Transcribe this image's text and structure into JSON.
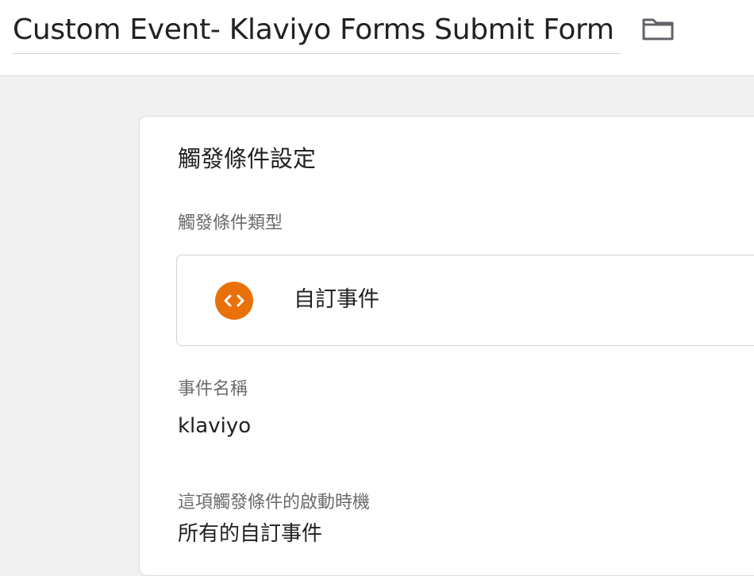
{
  "header": {
    "title": "Custom Event- Klaviyo Forms Submit Form",
    "folder_icon": "folder-icon"
  },
  "trigger_config": {
    "section_title": "觸發條件設定",
    "trigger_type_label": "觸發條件類型",
    "trigger_type_value": "自訂事件",
    "trigger_type_icon": "code-brackets-icon",
    "trigger_type_icon_color": "#e8710a",
    "event_name_label": "事件名稱",
    "event_name_value": "klaviyo",
    "fires_on_label": "這項觸發條件的啟動時機",
    "fires_on_value": "所有的自訂事件"
  }
}
